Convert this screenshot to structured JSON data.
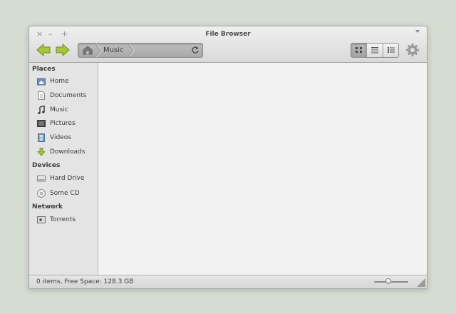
{
  "window": {
    "title": "File Browser",
    "controls": {
      "close": "×",
      "minimize": "–",
      "maximize": "+"
    }
  },
  "toolbar": {
    "path": [
      "Music"
    ],
    "view_modes": [
      "icon-view",
      "list-view",
      "column-view"
    ],
    "active_view": "icon-view"
  },
  "sidebar": {
    "sections": [
      {
        "heading": "Places",
        "items": [
          {
            "label": "Home",
            "icon": "home-folder-icon"
          },
          {
            "label": "Documents",
            "icon": "document-icon"
          },
          {
            "label": "Music",
            "icon": "music-note-icon"
          },
          {
            "label": "Pictures",
            "icon": "picture-icon"
          },
          {
            "label": "Videos",
            "icon": "film-icon"
          },
          {
            "label": "Downloads",
            "icon": "download-arrow-icon"
          }
        ]
      },
      {
        "heading": "Devices",
        "items": [
          {
            "label": "Hard Drive",
            "icon": "hard-drive-icon"
          },
          {
            "label": "Some CD",
            "icon": "cd-icon"
          }
        ]
      },
      {
        "heading": "Network",
        "items": [
          {
            "label": "Torrents",
            "icon": "network-folder-icon"
          }
        ]
      }
    ]
  },
  "status": {
    "text": "0 items, Free Space: 128.3 GB",
    "zoom_level": 0.4
  },
  "colors": {
    "desktop": "#d5dcd2",
    "nav_arrow": "#a8c83a",
    "download_arrow": "#9fc43a"
  }
}
